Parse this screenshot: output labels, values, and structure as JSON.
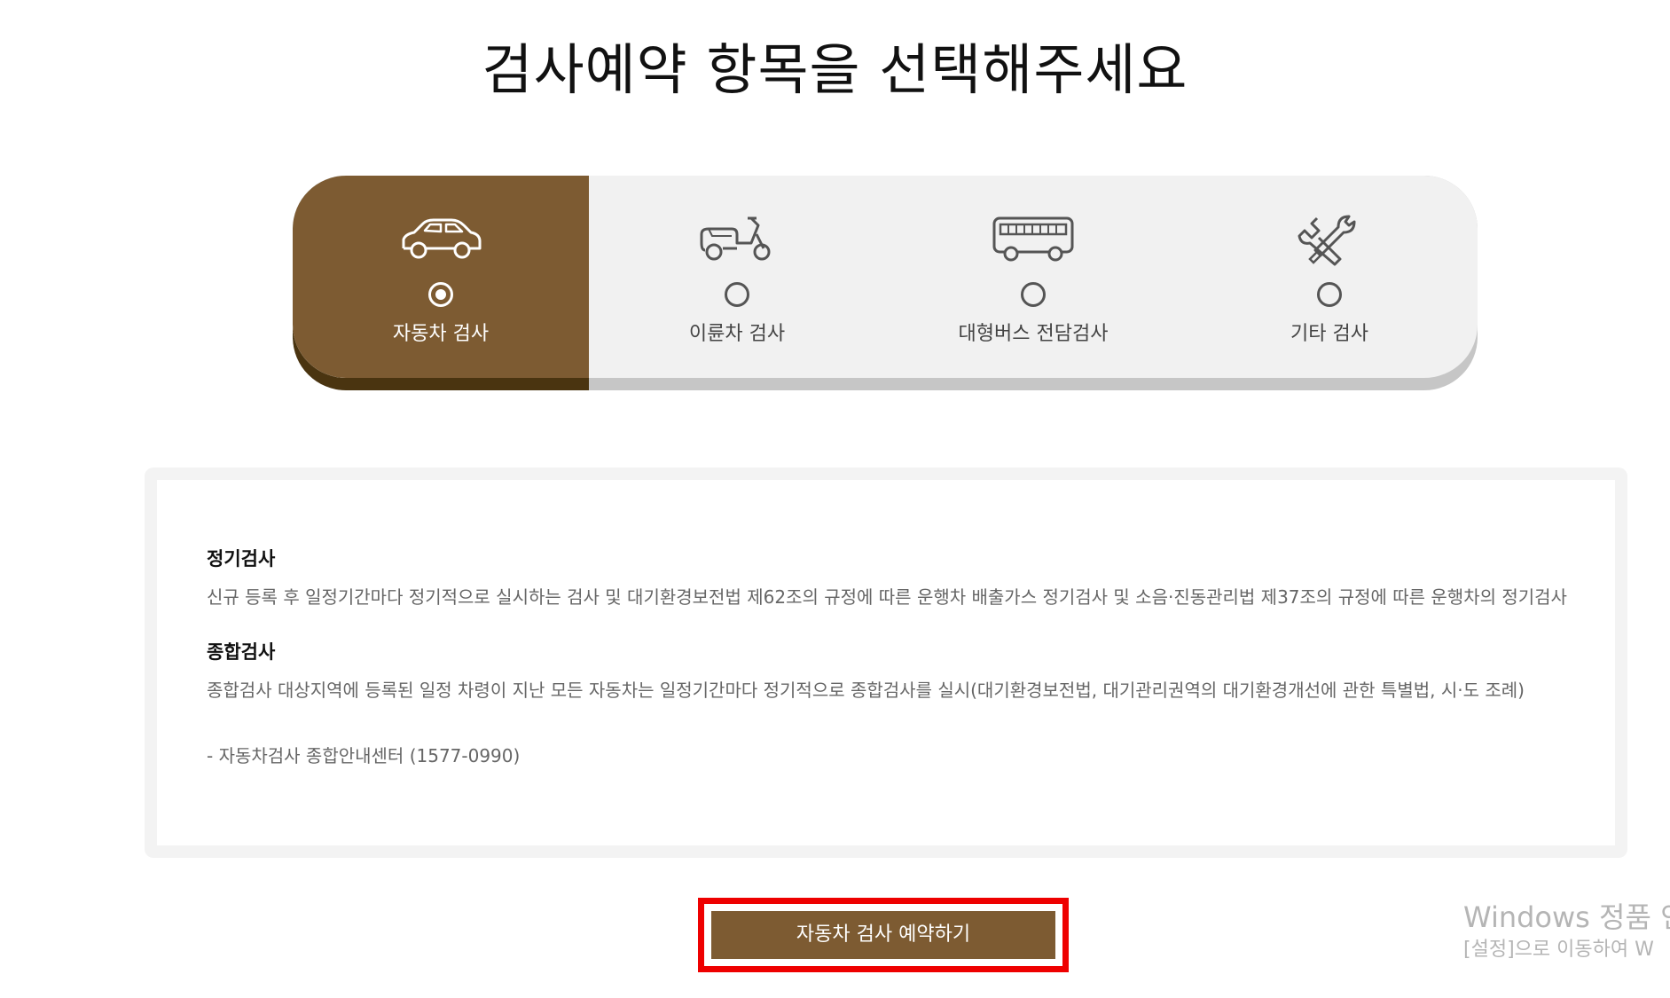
{
  "page": {
    "title": "검사예약 항목을 선택해주세요"
  },
  "options": [
    {
      "label": "자동차 검사",
      "icon": "car-icon",
      "selected": true
    },
    {
      "label": "이륜차 검사",
      "icon": "scooter-icon",
      "selected": false
    },
    {
      "label": "대형버스 전담검사",
      "icon": "bus-icon",
      "selected": false
    },
    {
      "label": "기타 검사",
      "icon": "tools-icon",
      "selected": false
    }
  ],
  "description": {
    "sections": [
      {
        "heading": "정기검사",
        "text": "신규 등록 후 일정기간마다 정기적으로 실시하는 검사 및 대기환경보전법 제62조의 규정에 따른 운행차 배출가스 정기검사 및 소음·진동관리법 제37조의 규정에 따른 운행차의 정기검사"
      },
      {
        "heading": "종합검사",
        "text": "종합검사 대상지역에 등록된 일정 차령이 지난 모든 자동차는 일정기간마다 정기적으로 종합검사를 실시(대기환경보전법, 대기관리권역의 대기환경개선에 관한 특별법, 시·도 조례)"
      }
    ],
    "contact": "- 자동차검사 종합안내센터 (1577-0990)"
  },
  "reserve_button": {
    "label": "자동차 검사 예약하기"
  },
  "watermark": {
    "title": "Windows 정품 인",
    "subtitle": "[설정]으로 이동하여 W"
  },
  "colors": {
    "accent": "#7d5b32",
    "accent_shadow": "#4a3410",
    "highlight_border": "#ee0000"
  }
}
